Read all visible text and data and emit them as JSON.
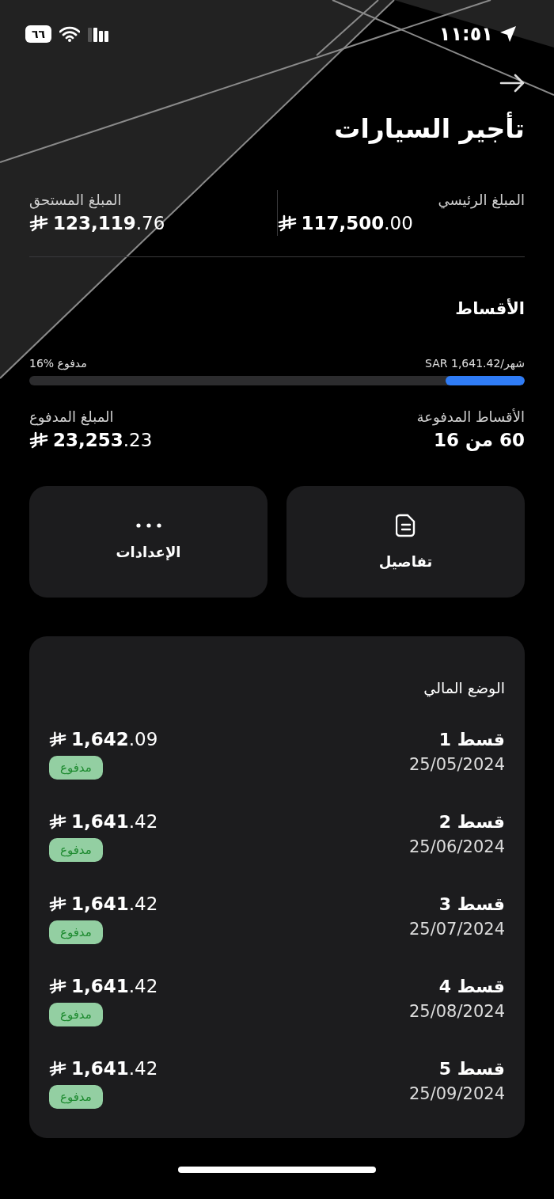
{
  "status_bar": {
    "time": "١١:٥١",
    "battery": "٦٦"
  },
  "title": "تأجير السيارات",
  "amounts": [
    {
      "label": "المبلغ الرئيسي",
      "value": "**117,500**.00"
    },
    {
      "label": "المبلغ المستحق",
      "value": "**123,119**.76"
    }
  ],
  "installments": {
    "heading": "الأقساط",
    "monthly": "SAR 1,641.42/شهر",
    "paid_percent": "16% مدفوع",
    "level": 0.16
  },
  "stats": [
    {
      "label": "الأقساط المدفوعة",
      "value": "60 من 16",
      "kind": "count"
    },
    {
      "label": "المبلغ المدفوع",
      "value": "**23,253**.23",
      "kind": "money"
    }
  ],
  "actions": [
    {
      "label": "تفاصيل",
      "kind": "details"
    },
    {
      "label": "الإعدادات",
      "kind": "more"
    }
  ],
  "financial_status": {
    "heading": "الوضع المالي",
    "rows": [
      {
        "name": "قسط 1",
        "date": "25/05/2024",
        "amount": "**1,642**.09",
        "status": "مدفوع"
      },
      {
        "name": "قسط 2",
        "date": "25/06/2024",
        "amount": "**1,641**.42",
        "status": "مدفوع"
      },
      {
        "name": "قسط 3",
        "date": "25/07/2024",
        "amount": "**1,641**.42",
        "status": "مدفوع"
      },
      {
        "name": "قسط 4",
        "date": "25/08/2024",
        "amount": "**1,641**.42",
        "status": "مدفوع"
      },
      {
        "name": "قسط 5",
        "date": "25/09/2024",
        "amount": "**1,641**.42",
        "status": "مدفوع"
      }
    ]
  }
}
